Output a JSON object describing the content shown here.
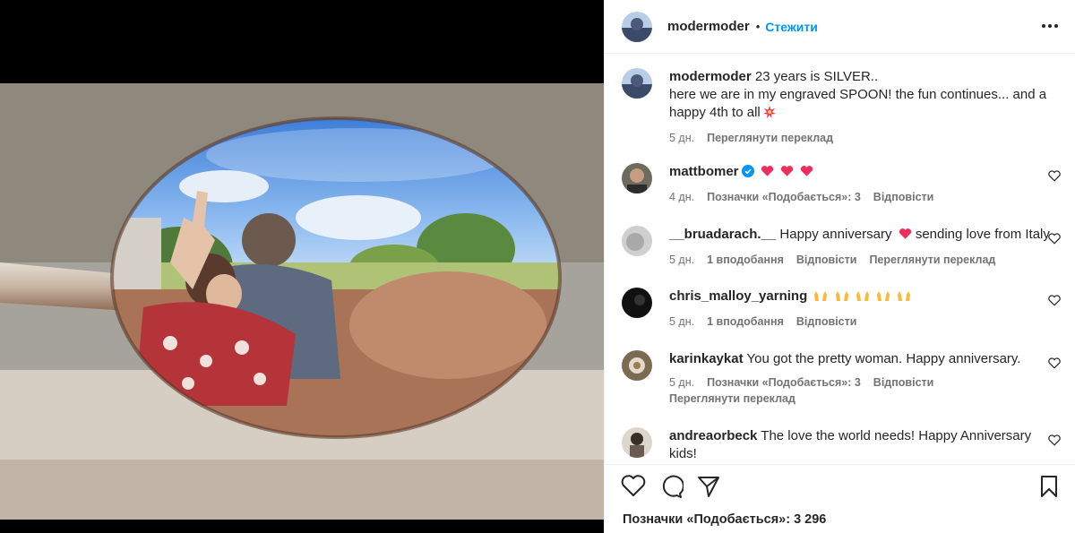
{
  "post": {
    "username": "modermoder",
    "follow_label": "Стежити",
    "dot": "•",
    "likes_text": "Позначки «Подобається»: 3 296"
  },
  "caption": {
    "username": "modermoder",
    "line1": "23 years is SILVER..",
    "line2": "here we are in my engraved SPOON! the fun continues... and a happy 4th to all",
    "emoji": "collision-emoji",
    "time": "5 дн.",
    "translate": "Переглянути переклад"
  },
  "comments": [
    {
      "username": "mattbomer",
      "verified": true,
      "text": "",
      "emojis": [
        "heart",
        "heart",
        "heart"
      ],
      "time": "4 дн.",
      "likes": "Позначки «Подобається»: 3",
      "reply": "Відповісти"
    },
    {
      "username": "__bruadarach.__",
      "text_before": "Happy anniversary",
      "text_after": "sending love from Italy",
      "time": "5 дн.",
      "likes": "1 вподобання",
      "reply": "Відповісти",
      "translate": "Переглянути переклад"
    },
    {
      "username": "chris_malloy_yarning",
      "emojis": [
        "raising-hands",
        "raising-hands",
        "raising-hands",
        "raising-hands",
        "raising-hands"
      ],
      "time": "5 дн.",
      "likes": "1 вподобання",
      "reply": "Відповісти"
    },
    {
      "username": "karinkaykat",
      "text": "You got the pretty woman. Happy anniversary.",
      "time": "5 дн.",
      "likes": "Позначки «Подобається»: 3",
      "reply": "Відповісти",
      "translate": "Переглянути переклад"
    },
    {
      "username": "andreaorbeck",
      "text": "The love the world needs! Happy Anniversary kids!"
    }
  ],
  "icons": {
    "more": "more-options-icon",
    "like": "heart-outline-icon",
    "comment": "comment-bubble-icon",
    "share": "paper-plane-icon",
    "save": "bookmark-icon"
  },
  "colors": {
    "link": "#0095f6",
    "verified": "#0095f6",
    "heart": "#ed2e5a",
    "text": "#262626",
    "muted": "#737373"
  }
}
